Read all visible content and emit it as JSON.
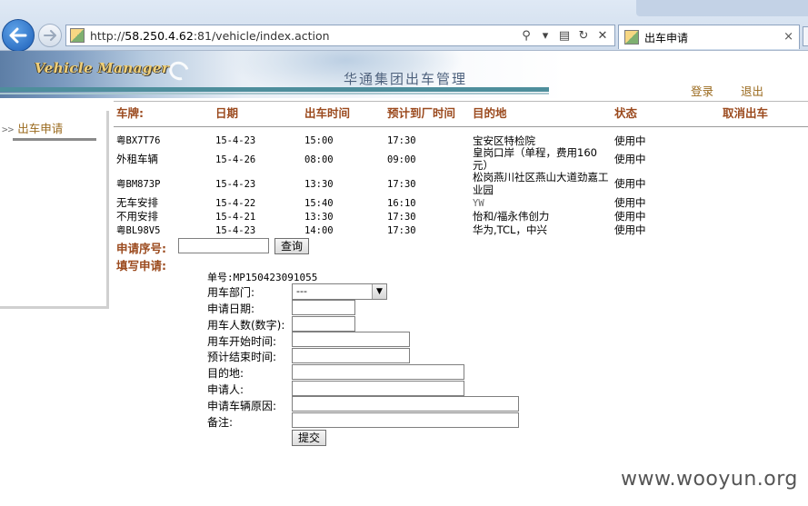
{
  "browser": {
    "url_prefix": "http://",
    "url_host": "58.250.4.62",
    "url_path": ":81/vehicle/index.action",
    "tab_title": "出车申请",
    "search_glyph": "⚲",
    "dropdown_glyph": "▾",
    "compat_glyph": "▤",
    "refresh_glyph": "↻",
    "stop_glyph": "✕",
    "close_glyph": "×"
  },
  "banner": {
    "logo_text": "Vehicle Manager",
    "company_text": "华通集团出车管理",
    "login": "登录",
    "logout": "退出"
  },
  "sidebar": {
    "arrow": ">>",
    "item": "出车申请"
  },
  "table": {
    "headers": [
      "车牌:",
      "日期",
      "出车时间",
      "预计到厂时间",
      "目的地",
      "状态",
      "取消出车"
    ],
    "rows": [
      {
        "plate": "粤BX7T76",
        "date": "15-4-23",
        "out": "15:00",
        "back": "17:30",
        "dest": "宝安区特检院",
        "status": "使用中"
      },
      {
        "plate": "外租车辆",
        "date": "15-4-26",
        "out": "08:00",
        "back": "09:00",
        "dest": "皇岗口岸（单程，费用160元）",
        "status": "使用中"
      },
      {
        "plate": "粤BM873P",
        "date": "15-4-23",
        "out": "13:30",
        "back": "17:30",
        "dest": "松岗燕川社区燕山大道劲嘉工业园",
        "status": "使用中"
      },
      {
        "plate": "无车安排",
        "date": "15-4-22",
        "out": "15:40",
        "back": "16:10",
        "dest": "YW",
        "status": "使用中"
      },
      {
        "plate": "不用安排",
        "date": "15-4-21",
        "out": "13:30",
        "back": "17:30",
        "dest": "怡和/福永伟创力",
        "status": "使用中"
      },
      {
        "plate": "粤BL98V5",
        "date": "15-4-23",
        "out": "14:00",
        "back": "17:30",
        "dest": "华为,TCL，中兴",
        "status": "使用中"
      }
    ]
  },
  "query": {
    "label": "申请序号:",
    "value": "",
    "button": "查询"
  },
  "form": {
    "section_label": "填写申请:",
    "order_no": "单号:MP150423091055",
    "dept_label": "用车部门:",
    "dept_value": "---",
    "date_label": "申请日期:",
    "count_label": "用车人数(数字):",
    "start_label": "用车开始时间:",
    "end_label": "预计结束时间:",
    "dest_label": "目的地:",
    "applicant_label": "申请人:",
    "reason_label": "申请车辆原因:",
    "remark_label": "备注:",
    "submit": "提交"
  },
  "watermark": "www.wooyun.org"
}
